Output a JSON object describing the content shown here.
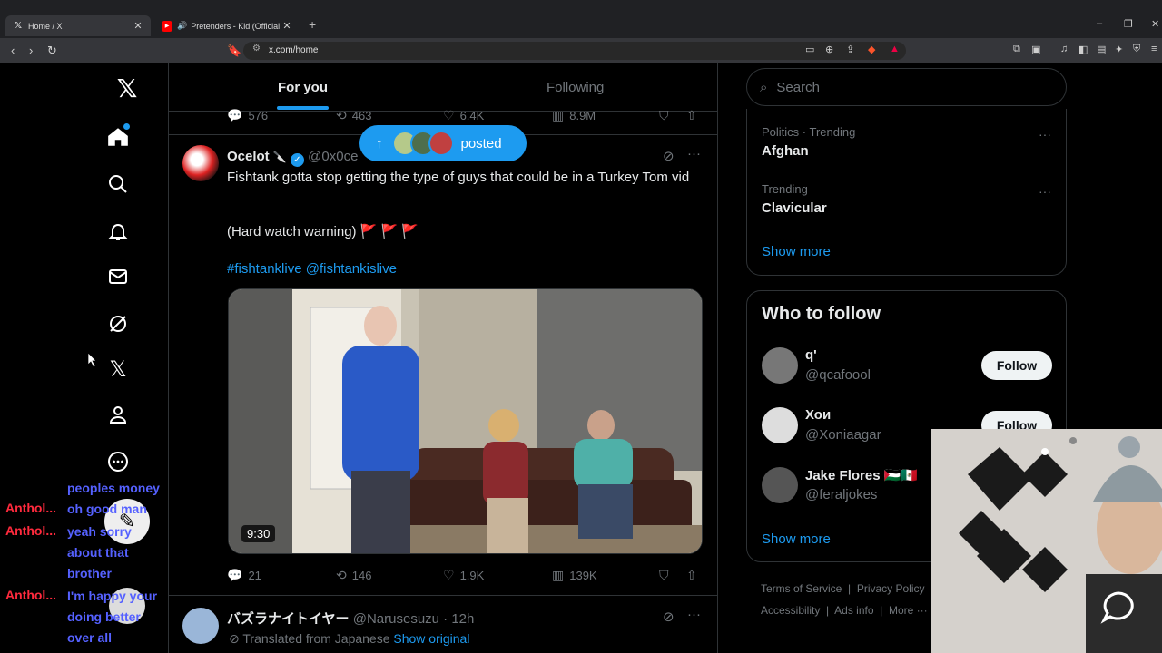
{
  "browser": {
    "tabs": [
      {
        "title": "Home / X",
        "active": true
      },
      {
        "title": "Pretenders - Kid (Official Music V",
        "active": false
      }
    ],
    "url": "x.com/home"
  },
  "header": {
    "tabs": [
      "For you",
      "Following"
    ]
  },
  "top_actions": {
    "replies": "576",
    "reposts": "463",
    "likes": "6.4K",
    "views": "8.9M"
  },
  "new_posts_pill": {
    "label": "posted"
  },
  "tweet1": {
    "name": "Ocelot",
    "handle": "@0x0ce",
    "text": "Fishtank gotta stop getting the type of guys that could be in a Turkey Tom vid",
    "line2": "(Hard watch warning)",
    "flags": "🚩 🚩 🚩",
    "tags": "#fishtanklive @fishtankislive",
    "duration": "9:30",
    "replies": "21",
    "reposts": "146",
    "likes": "1.9K",
    "views": "139K"
  },
  "tweet2": {
    "name": "バズラナイトイヤー",
    "handle": "@Narusesuzu · 12h",
    "translated": "Translated from Japanese",
    "show_original": "Show original"
  },
  "search": {
    "placeholder": "Search"
  },
  "trends": [
    {
      "category": "Politics · Trending",
      "name": "Afghan"
    },
    {
      "category": "Trending",
      "name": "Clavicular"
    }
  ],
  "trends_show_more": "Show more",
  "who_to_follow": {
    "title": "Who to follow",
    "users": [
      {
        "name": "q'",
        "handle": "@qcafoool",
        "button": "Follow"
      },
      {
        "name": "Хои",
        "handle": "@Xoniaagar",
        "button": "Follow"
      },
      {
        "name": "Jake Flores 🇵🇸🇲🇽",
        "handle": "@feraljokes",
        "button": "Follow"
      }
    ],
    "show_more": "Show more"
  },
  "footer": {
    "row1": [
      "Terms of Service",
      "Privacy Policy"
    ],
    "row2": [
      "Accessibility",
      "Ads info",
      "More ···"
    ]
  },
  "chat": {
    "users": [
      "Anthol...",
      "Anthol...",
      "Anthol..."
    ],
    "messages": [
      "peoples money",
      "oh good man",
      "yeah sorry about that brother",
      "I'm happy your doing better over all"
    ]
  },
  "colors": {
    "accent": "#1d9bf0",
    "chat_name": "#ff2a3d",
    "chat_msg": "#5561ff"
  }
}
